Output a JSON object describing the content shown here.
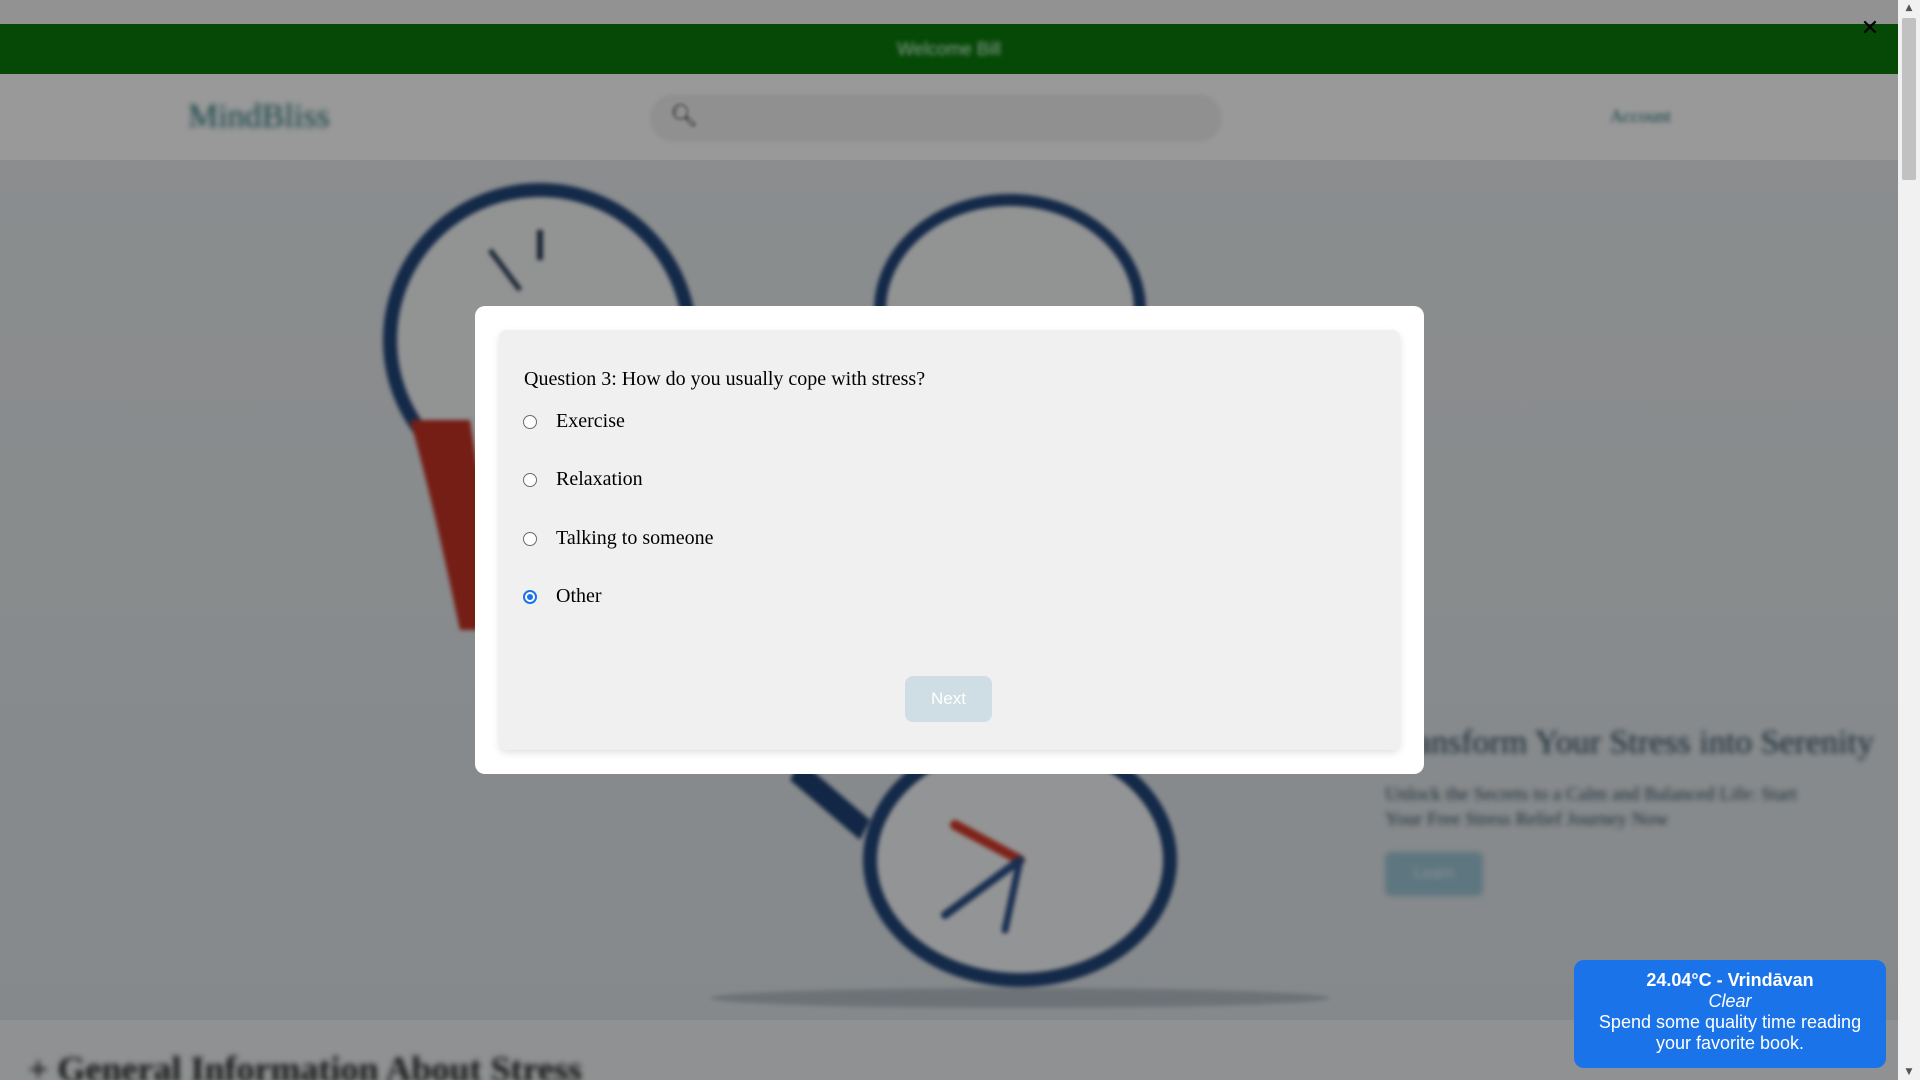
{
  "banner": {
    "text": "Welcome Bill"
  },
  "header": {
    "logo": "MindBliss",
    "search_icon": "search-icon",
    "nav_link": "Account"
  },
  "hero": {
    "title": "Transform Your Stress into Serenity",
    "subtitle": "Unlock the Secrets to a Calm and Balanced Life: Start Your Free Stress Relief Journey Now",
    "cta_label": "Learn"
  },
  "section": {
    "heading": "+ General Information About Stress"
  },
  "close_icon": "close-icon",
  "quiz": {
    "question": "Question 3: How do you usually cope with stress?",
    "options": [
      {
        "label": "Exercise",
        "checked": false
      },
      {
        "label": "Relaxation",
        "checked": false
      },
      {
        "label": "Talking to someone",
        "checked": false
      },
      {
        "label": "Other",
        "checked": true
      }
    ],
    "next_label": "Next"
  },
  "weather": {
    "temperature_location": "24.04°C - Vrindāvan",
    "condition": "Clear",
    "tip": "Spend some quality time reading your favorite book."
  },
  "colors": {
    "banner": "#0b7a0b",
    "accent": "#1a73e8",
    "next_disabled": "#cfdde4"
  }
}
